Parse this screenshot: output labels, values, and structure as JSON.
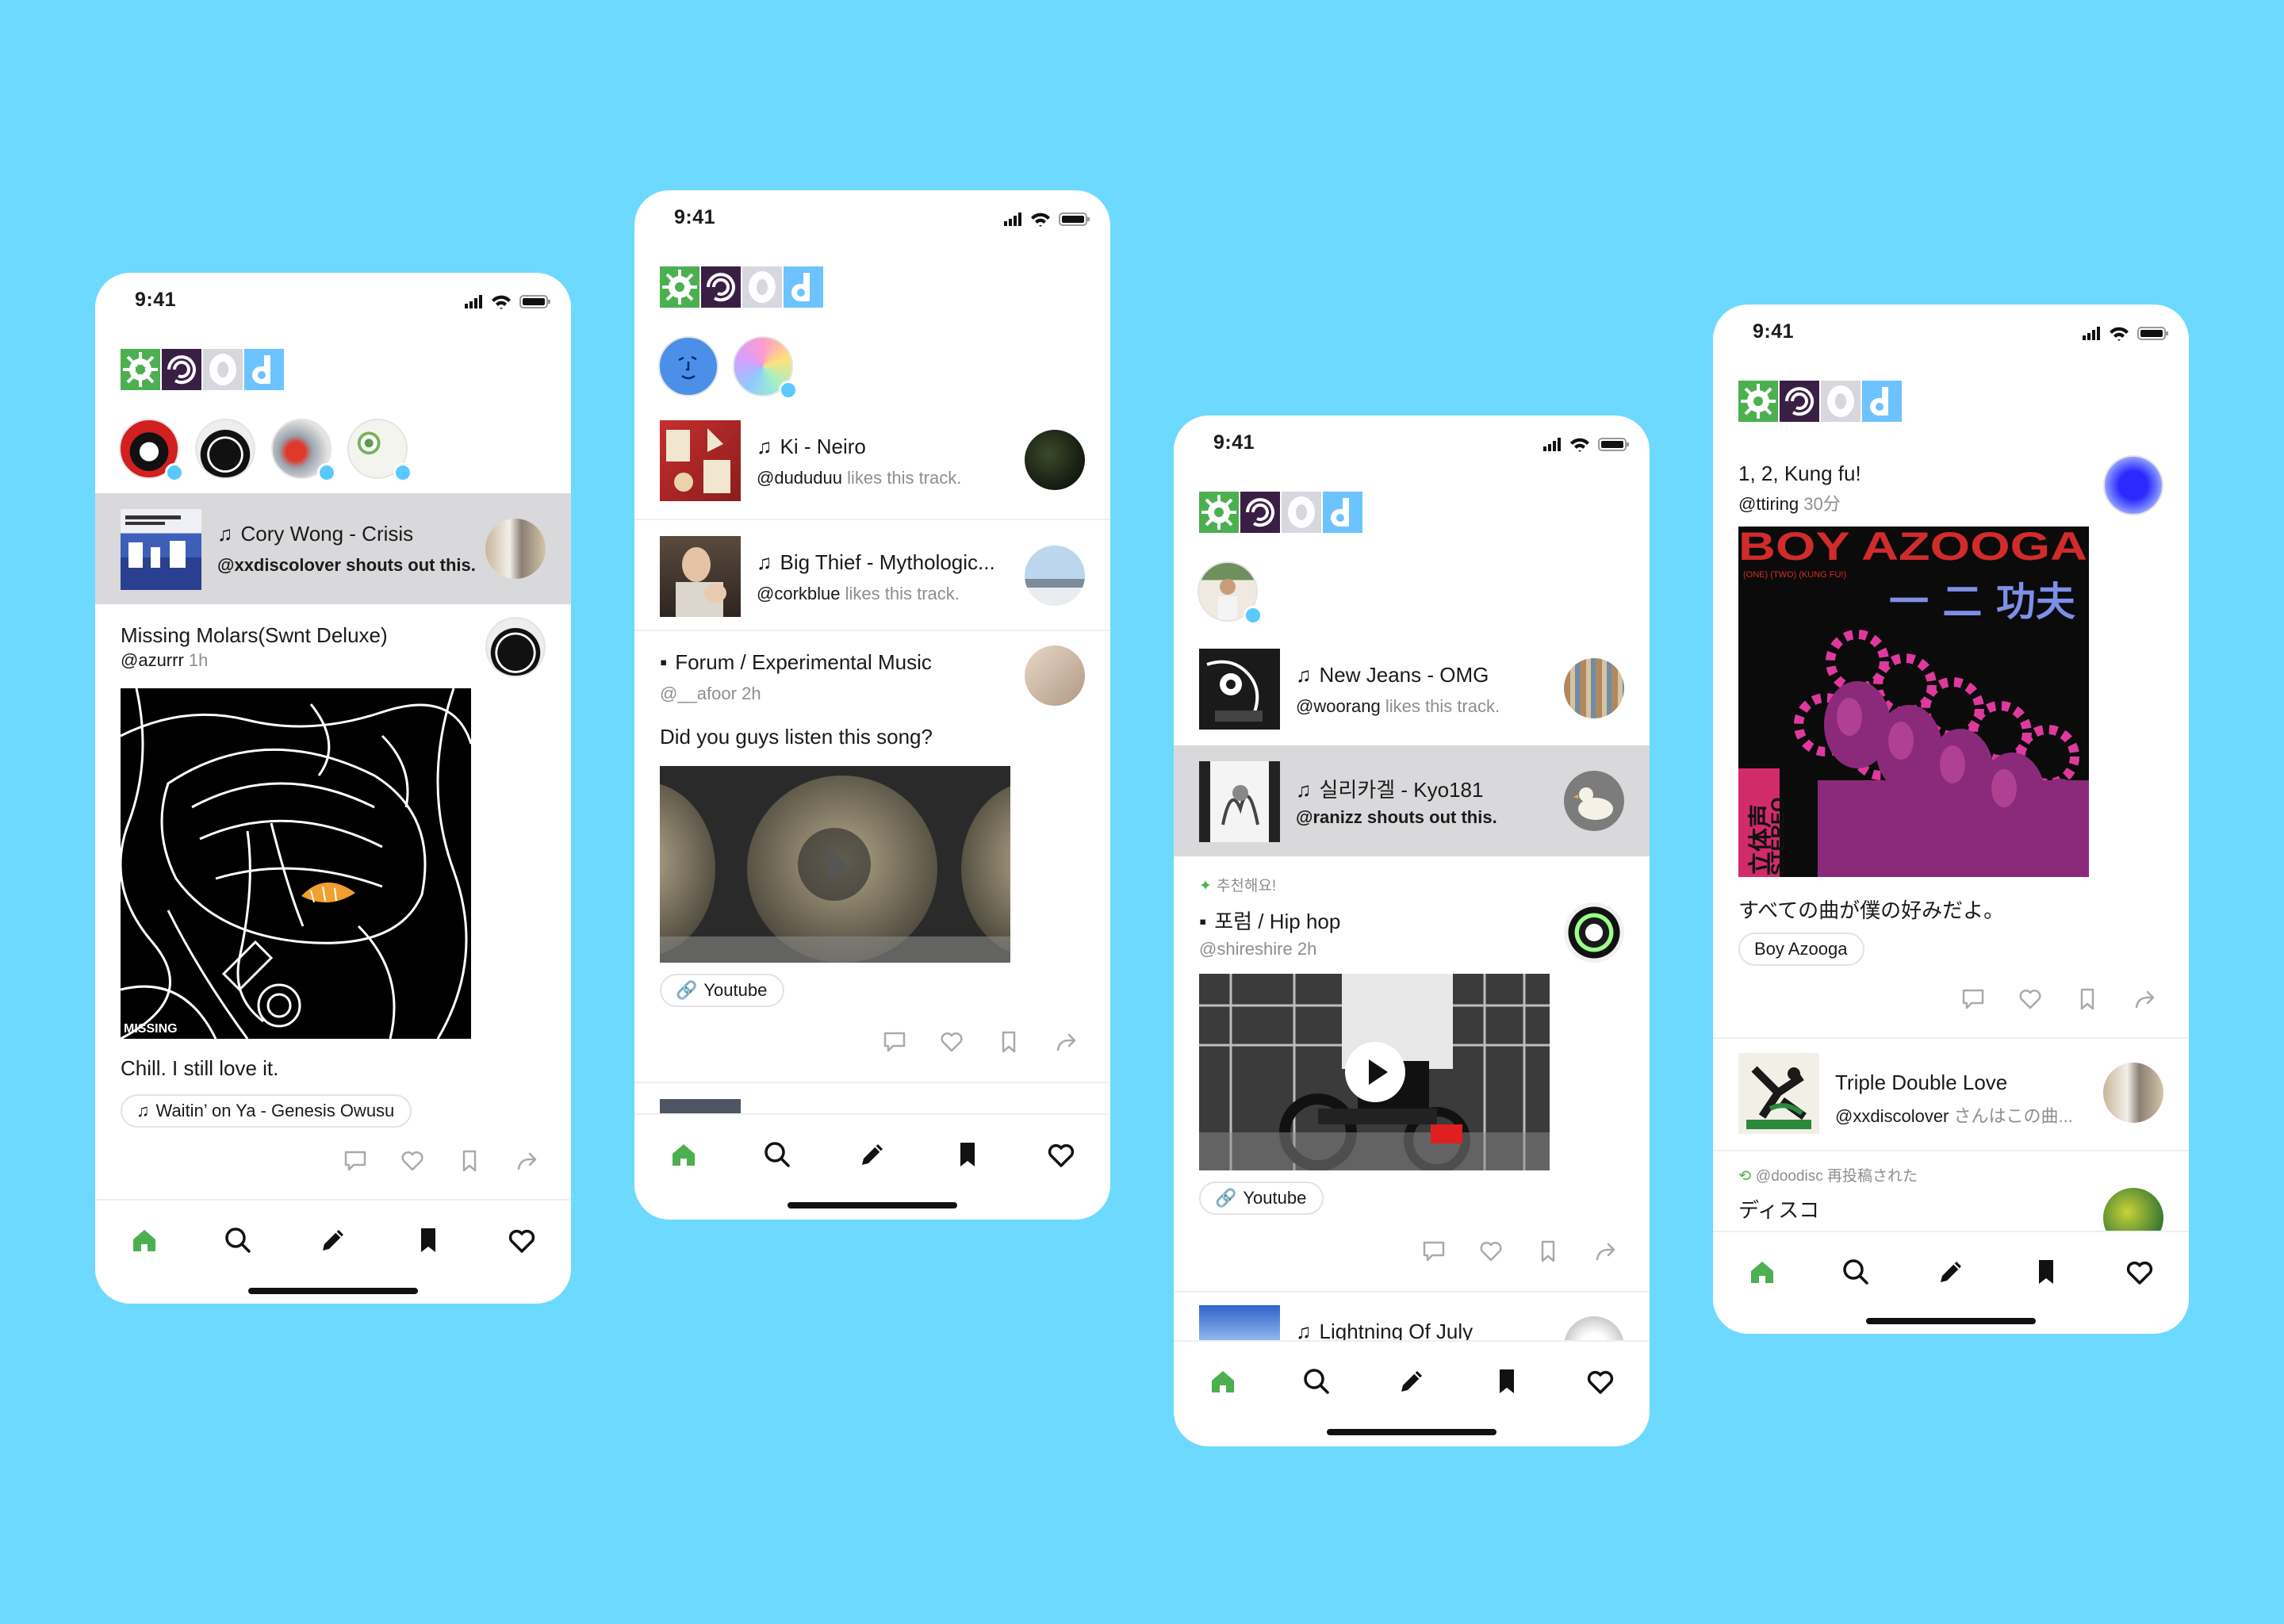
{
  "status_time": "9:41",
  "nav": [
    "home-icon",
    "search-icon",
    "compose-icon",
    "bookmark-icon",
    "heart-icon"
  ],
  "colors": {
    "background": "#6DD9FF",
    "accent_green": "#4CAF50",
    "story_dot": "#5BC8FF",
    "highlight_row": "#D9D9DC"
  },
  "phone1": {
    "shoutout": {
      "title": "Cory Wong - Crisis",
      "user": "@xxdiscolover",
      "suffix": " shouts out this."
    },
    "post": {
      "title": "Missing Molars(Swnt Deluxe)",
      "user": "@azurrr",
      "time": "1h",
      "album_label": "MISSING",
      "caption": "Chill. I still love it.",
      "track": "Waitin’ on Ya - Genesis Owusu"
    }
  },
  "phone2": {
    "tracks": [
      {
        "title": "Ki - Neiro",
        "user": "@dududuu",
        "suffix": " likes this track."
      },
      {
        "title": "Big Thief - Mythologic...",
        "user": "@corkblue",
        "suffix": " likes this track."
      }
    ],
    "post": {
      "title": "Forum / Experimental Music",
      "user": "@__afoor",
      "time": "2h",
      "text": "Did you guys listen this song?",
      "link": "Youtube"
    }
  },
  "phone3": {
    "tracks": [
      {
        "title": "New Jeans - OMG",
        "user": "@woorang",
        "suffix": " likes this track."
      },
      {
        "title": "실리카겔 - Kyo181",
        "user": "@ranizz",
        "suffix": " shouts out this."
      }
    ],
    "recommend": "추천해요!",
    "post": {
      "title": "포럼 / Hip hop",
      "user": "@shireshire",
      "time": "2h",
      "link": "Youtube"
    },
    "next_title": "Lightning Of July"
  },
  "phone4": {
    "post": {
      "title": "1, 2, Kung fu!",
      "user": "@ttiring",
      "time": "30分",
      "album_title": "BOY AZOOGA",
      "album_sub": "(ONE)    (TWO)    (KUNG FU!)",
      "album_jp": "一 二 功夫",
      "album_side_a": "立体声",
      "album_side_b": "STEREO",
      "caption": "すべての曲が僕の好みだよ。",
      "tag": "Boy Azooga"
    },
    "track": {
      "title": "Triple Double Love",
      "user": "@xxdiscolover",
      "suffix": " さんはこの曲..."
    },
    "repost": {
      "label": "@doodisc 再投稿された",
      "title": "ディスコ"
    }
  }
}
